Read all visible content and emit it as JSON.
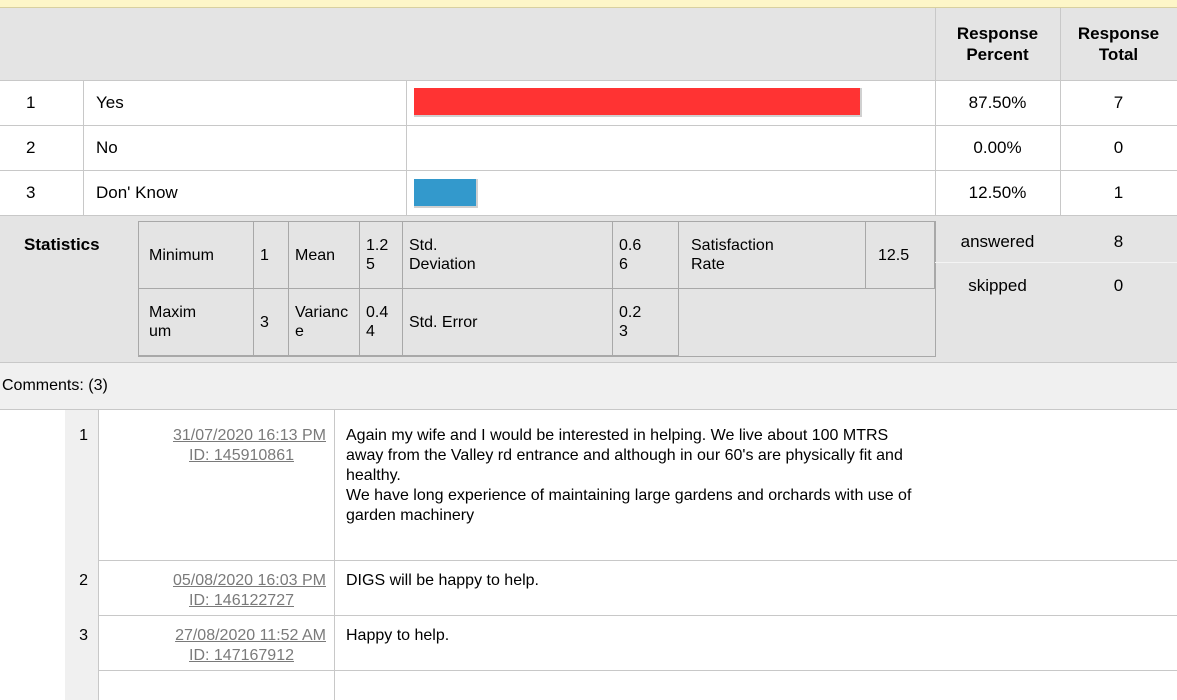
{
  "header": {
    "response_percent": "Response Percent",
    "response_total": "Response Total"
  },
  "rows": [
    {
      "num": "1",
      "label": "Yes",
      "percent_text": "87.50%",
      "total": "7",
      "fraction": 0.875
    },
    {
      "num": "2",
      "label": "No",
      "percent_text": "0.00%",
      "total": "0",
      "fraction": 0.0
    },
    {
      "num": "3",
      "label": "Don' Know",
      "percent_text": "12.50%",
      "total": "1",
      "fraction": 0.125
    }
  ],
  "bar_colors": {
    "yes": "#ff3333",
    "dont_know": "#3399cc"
  },
  "statistics": {
    "label": "Statistics",
    "minimum_label": "Minimum",
    "minimum_value": "1",
    "mean_label": "Mean",
    "mean_value": "1.25",
    "std_dev_label": "Std. Deviation",
    "std_dev_value": "0.66",
    "satisfaction_label": "Satisfaction Rate",
    "satisfaction_value": "12.5",
    "maximum_label": "Maximum",
    "maximum_value": "3",
    "variance_label": "Variance",
    "variance_value": "0.44",
    "std_error_label": "Std. Error",
    "std_error_value": "0.23"
  },
  "summary": {
    "answered_label": "answered",
    "answered_value": "8",
    "skipped_label": "skipped",
    "skipped_value": "0"
  },
  "comments": {
    "heading": "Comments: (3)",
    "items": [
      {
        "num": "1",
        "date": "31/07/2020 16:13 PM",
        "id": "ID: 145910861",
        "text_lines": [
          "Again my wife and I would be interested in helping. We live about 100 MTRS",
          "away from the Valley rd entrance and although in our 60's are physically fit and",
          "healthy.",
          "We have long experience of maintaining large gardens and orchards with use of",
          "garden machinery"
        ]
      },
      {
        "num": "2",
        "date": "05/08/2020 16:03 PM",
        "id": "ID: 146122727",
        "text_lines": [
          "DIGS will be happy to help."
        ]
      },
      {
        "num": "3",
        "date": "27/08/2020 11:52 AM",
        "id": "ID: 147167912",
        "text_lines": [
          "Happy to help."
        ]
      }
    ]
  }
}
